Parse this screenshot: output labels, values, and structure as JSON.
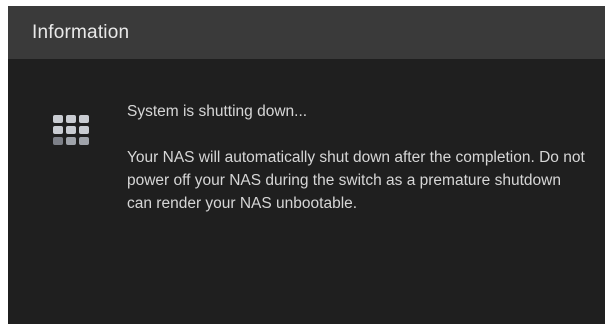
{
  "dialog": {
    "title": "Information",
    "status_text": "System is shutting down...",
    "detail_text": "Your NAS will automatically shut down after the completion. Do not power off your NAS during the switch as a premature shutdown can render your NAS unbootable.",
    "icon": "loading-grid-icon"
  },
  "colors": {
    "titlebar_bg": "#3a3a3a",
    "dialog_bg": "#1f1f1f",
    "title_text": "#e9e9e9",
    "body_text": "#d6d6d6",
    "icon_light": "#c9ccd2",
    "icon_dim": "#7d8088"
  }
}
